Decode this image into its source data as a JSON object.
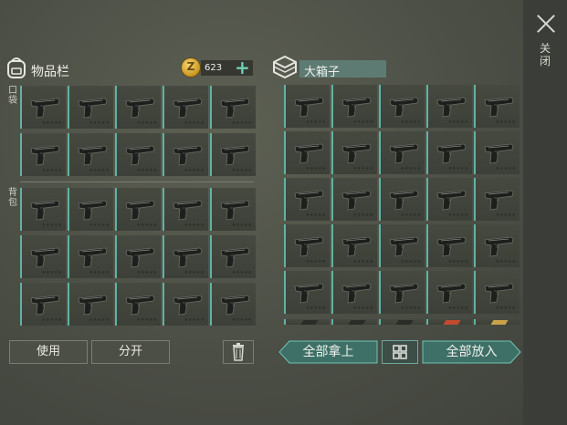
{
  "inventory": {
    "title": "物品栏",
    "coins": "623",
    "coin_symbol": "Z",
    "pocket_label": "口袋",
    "backpack_label": "背包",
    "slot_count_pocket": 10,
    "slot_count_backpack": 15,
    "item_icon": "pistol-icon",
    "use_label": "使用",
    "split_label": "分开"
  },
  "chest": {
    "title": "大箱子",
    "take_all_label": "全部拿上",
    "put_all_label": "全部放入"
  },
  "close_label": "关闭",
  "colors": {
    "accent": "#5fb3a5",
    "background": "#4b4e45",
    "gold": "#f6d774"
  }
}
